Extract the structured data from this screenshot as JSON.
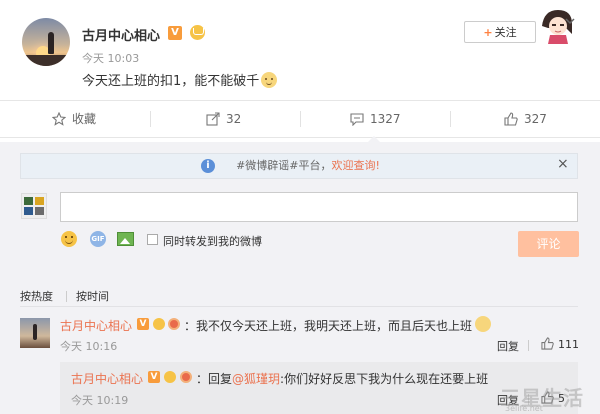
{
  "post": {
    "username": "古月中心相心",
    "verified_badge": "V",
    "time": "今天 10:03",
    "text": "今天还上班的扣1，能不能破千",
    "follow_label": "关注",
    "actions": {
      "favorite_label": "收藏",
      "forward_count": "32",
      "comment_count": "1327",
      "like_count": "327"
    }
  },
  "comment_box": {
    "notice_topic": "#微博辟谣#平台，",
    "notice_link": "欢迎查询!",
    "also_forward_label": "同时转发到我的微博",
    "submit_label": "评论",
    "gif_label": "GIF"
  },
  "sort": {
    "hot_label": "按热度",
    "latest_label": "按时间"
  },
  "comments": [
    {
      "username": "古月中心相心",
      "badge": "V",
      "text": "：我不仅今天还上班，我明天还上班，而且后天也上班",
      "time": "今天 10:16",
      "reply_label": "回复",
      "likes": "111"
    }
  ],
  "reply": {
    "username": "古月中心相心",
    "badge": "V",
    "prefix": "：回复",
    "mention": "@狐瑾玥",
    "text": ":你们好好反思下我为什么现在还要上班",
    "time": "今天 10:19",
    "reply_label": "回复",
    "likes": "5"
  },
  "watermark": {
    "text": "三星生活",
    "sub": "3elife.net"
  },
  "colors": {
    "accent_orange": "#eb7350",
    "submit_disabled": "#ffc09f",
    "panel_bg": "#f2f2f5"
  }
}
